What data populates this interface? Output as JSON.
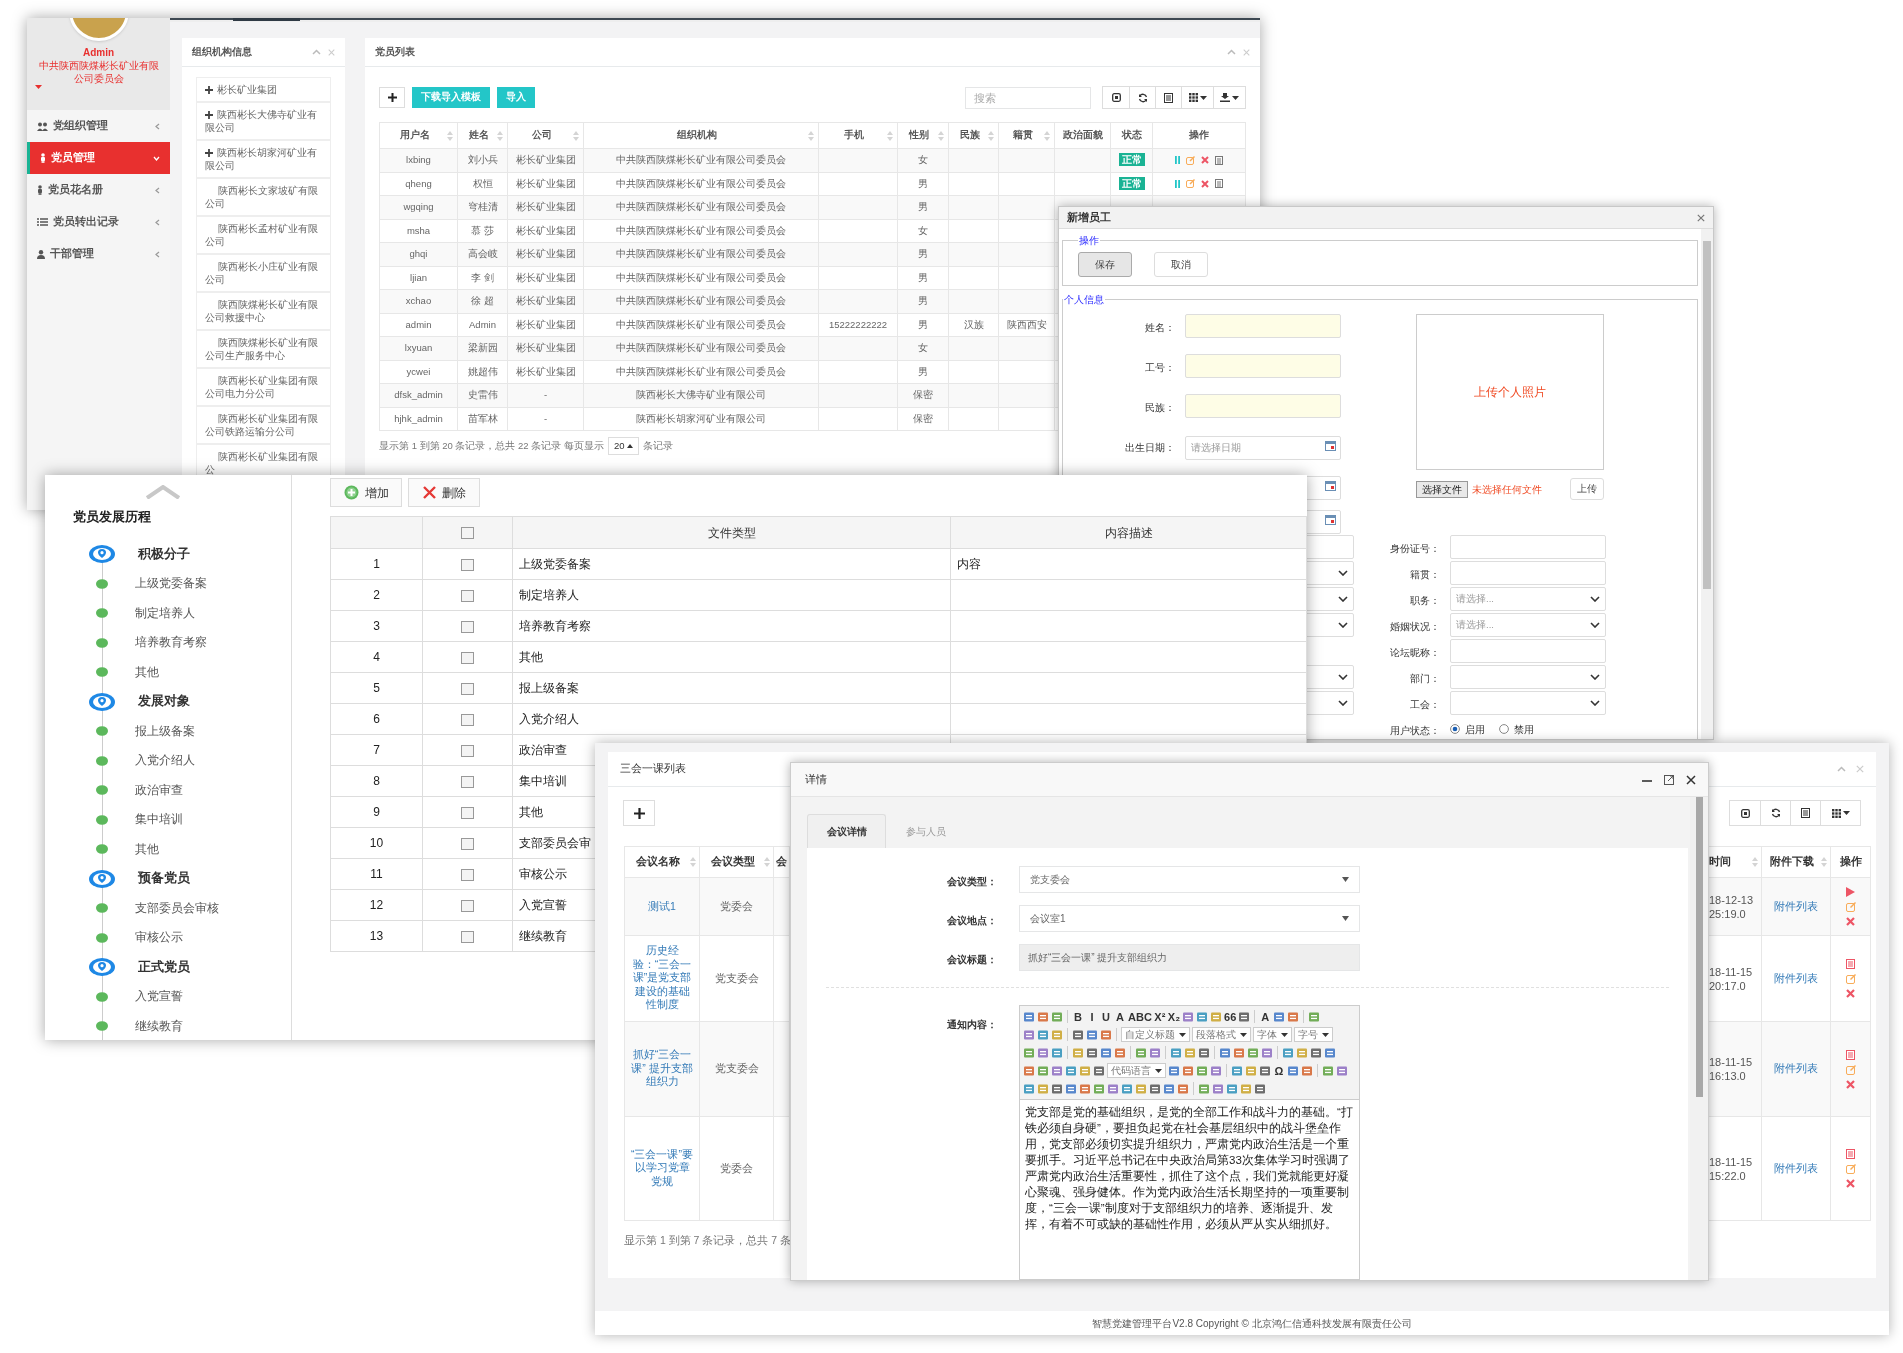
{
  "admin_window": {
    "sidebar": {
      "user_name": "Admin",
      "org_name": "中共陕西陕煤彬长矿业有限公司委员会",
      "menu": [
        {
          "label": "党组织管理",
          "selected": false
        },
        {
          "label": "党员管理",
          "selected": true
        },
        {
          "label": "党员花名册",
          "selected": false
        },
        {
          "label": "党员转出记录",
          "selected": false
        },
        {
          "label": "干部管理",
          "selected": false
        }
      ]
    },
    "org_panel": {
      "title": "组织机构信息",
      "items": [
        {
          "label": "彬长矿业集团",
          "expandable": true
        },
        {
          "label": "陕西彬长大佛寺矿业有限公司",
          "expandable": true
        },
        {
          "label": "陕西彬长胡家河矿业有限公司",
          "expandable": true
        },
        {
          "label": "陕西彬长文家坡矿有限公司",
          "expandable": false
        },
        {
          "label": "陕西彬长孟村矿业有限公司",
          "expandable": false
        },
        {
          "label": "陕西彬长小庄矿业有限公司",
          "expandable": false
        },
        {
          "label": "陕西陕煤彬长矿业有限公司救援中心",
          "expandable": false
        },
        {
          "label": "陕西陕煤彬长矿业有限公司生产服务中心",
          "expandable": false
        },
        {
          "label": "陕西彬长矿业集团有限公司电力分公司",
          "expandable": false
        },
        {
          "label": "陕西彬长矿业集团有限公司铁路运输分公司",
          "expandable": false
        },
        {
          "label": "陕西彬长矿业集团有限公",
          "expandable": false
        }
      ]
    },
    "member_panel": {
      "title": "党员列表",
      "buttons": [
        {
          "label": "下载导入模板"
        },
        {
          "label": "导入"
        }
      ],
      "search": {
        "placeholder": "搜索"
      },
      "columns": [
        {
          "label": "用户名",
          "sortable": true
        },
        {
          "label": "姓名",
          "sortable": true
        },
        {
          "label": "公司",
          "sortable": true
        },
        {
          "label": "组织机构",
          "sortable": true
        },
        {
          "label": "手机",
          "sortable": true
        },
        {
          "label": "性别",
          "sortable": true
        },
        {
          "label": "民族",
          "sortable": true
        },
        {
          "label": "籍贯",
          "sortable": true
        },
        {
          "label": "政治面貌",
          "sortable": false
        },
        {
          "label": "状态",
          "sortable": false
        },
        {
          "label": "操作",
          "sortable": false
        }
      ],
      "rows": [
        {
          "user": "lxbing",
          "name": "刘小兵",
          "company": "彬长矿业集团",
          "org": "中共陕西陕煤彬长矿业有限公司委员会",
          "gender": "女",
          "status": "正常",
          "actions": true
        },
        {
          "user": "qheng",
          "name": "权恒",
          "company": "彬长矿业集团",
          "org": "中共陕西陕煤彬长矿业有限公司委员会",
          "gender": "男",
          "status": "正常",
          "actions": true
        },
        {
          "user": "wgqing",
          "name": "穹桂清",
          "company": "彬长矿业集团",
          "org": "中共陕西陕煤彬长矿业有限公司委员会",
          "gender": "男",
          "actions": false
        },
        {
          "user": "msha",
          "name": "慕 莎",
          "company": "彬长矿业集团",
          "org": "中共陕西陕煤彬长矿业有限公司委员会",
          "gender": "女",
          "actions": false
        },
        {
          "user": "ghqi",
          "name": "高会岐",
          "company": "彬长矿业集团",
          "org": "中共陕西陕煤彬长矿业有限公司委员会",
          "gender": "男",
          "actions": false
        },
        {
          "user": "ljian",
          "name": "李 剑",
          "company": "彬长矿业集团",
          "org": "中共陕西陕煤彬长矿业有限公司委员会",
          "gender": "男",
          "actions": false
        },
        {
          "user": "xchao",
          "name": "徐 超",
          "company": "彬长矿业集团",
          "org": "中共陕西陕煤彬长矿业有限公司委员会",
          "gender": "男",
          "actions": false
        },
        {
          "user": "admin",
          "name": "Admin",
          "company": "彬长矿业集团",
          "org": "中共陕西陕煤彬长矿业有限公司委员会",
          "phone": "15222222222",
          "gender": "男",
          "nation": "汉族",
          "native": "陕西西安",
          "actions": false
        },
        {
          "user": "lxyuan",
          "name": "梁新园",
          "company": "彬长矿业集团",
          "org": "中共陕西陕煤彬长矿业有限公司委员会",
          "gender": "女",
          "actions": false
        },
        {
          "user": "ycwei",
          "name": "姚超伟",
          "company": "彬长矿业集团",
          "org": "中共陕西陕煤彬长矿业有限公司委员会",
          "gender": "男",
          "actions": false
        },
        {
          "user": "dfsk_admin",
          "name": "史雷伟",
          "company": "-",
          "org": "陕西彬长大佛寺矿业有限公司",
          "gender": "保密",
          "actions": false
        },
        {
          "user": "hjhk_admin",
          "name": "苗军林",
          "company": "-",
          "org": "陕西彬长胡家河矿业有限公司",
          "gender": "保密",
          "actions": false
        }
      ],
      "pagination": {
        "summary": "显示第 1 到第 20 条记录，总共 22 条记录 每页显示",
        "page_size": "20",
        "suffix": "条记录"
      }
    }
  },
  "new_employee_dialog": {
    "title": "新增员工",
    "actions_legend": "操作",
    "buttons": [
      {
        "label": "保存",
        "primary": true
      },
      {
        "label": "取消",
        "primary": false
      }
    ],
    "info_legend": "个人信息",
    "top_fields": [
      {
        "label": "姓名：",
        "kind": "text",
        "required": true
      },
      {
        "label": "工号：",
        "kind": "text",
        "required": true
      },
      {
        "label": "民族：",
        "kind": "text",
        "required": true
      },
      {
        "label": "出生日期：",
        "kind": "date",
        "placeholder": "请选择日期",
        "required": false
      },
      {
        "kind": "date",
        "required": false
      },
      {
        "kind": "date",
        "required": false
      }
    ],
    "photo": {
      "hint": "上传个人照片",
      "choose_button": "选择文件",
      "file_status": "未选择任何文件",
      "upload_button": "上传"
    },
    "rows": [
      {
        "left": {
          "kind": "text"
        },
        "right": {
          "label": "身份证号：",
          "kind": "text"
        }
      },
      {
        "left": {
          "kind": "select"
        },
        "right": {
          "label": "籍贯：",
          "kind": "text"
        }
      },
      {
        "left": {
          "kind": "select"
        },
        "right": {
          "label": "职务：",
          "kind": "select",
          "placeholder": "请选择..."
        }
      },
      {
        "left": {
          "kind": "select"
        },
        "right": {
          "label": "婚姻状况：",
          "kind": "select",
          "placeholder": "请选择..."
        }
      },
      {
        "right": {
          "label": "论坛昵称：",
          "kind": "text"
        }
      },
      {
        "left": {
          "kind": "select"
        },
        "right": {
          "label": "部门：",
          "kind": "select"
        }
      },
      {
        "left": {
          "kind": "select"
        },
        "right": {
          "label": "工会：",
          "kind": "select"
        }
      },
      {
        "right": {
          "label": "用户状态：",
          "kind": "radio",
          "options": [
            {
              "label": "启用",
              "selected": true
            },
            {
              "label": "禁用",
              "selected": false
            }
          ]
        }
      }
    ]
  },
  "development_window": {
    "timeline": {
      "title": "党员发展历程",
      "stages": [
        {
          "label": "积极分子",
          "steps": [
            "上级党委备案",
            "制定培养人",
            "培养教育考察",
            "其他"
          ]
        },
        {
          "label": "发展对象",
          "steps": [
            "报上级备案",
            "入党介绍人",
            "政治审查",
            "集中培训",
            "其他"
          ]
        },
        {
          "label": "预备党员",
          "steps": [
            "支部委员会审核",
            "审核公示"
          ]
        },
        {
          "label": "正式党员",
          "steps": [
            "入党宣誓",
            "继续教育"
          ]
        }
      ]
    },
    "toolbar": [
      {
        "kind": "add",
        "label": "增加"
      },
      {
        "kind": "delete",
        "label": "删除"
      }
    ],
    "columns": [
      "文件类型",
      "内容描述"
    ],
    "header_checked": false,
    "rows": [
      {
        "index": "1",
        "checked": false,
        "type": "上级党委备案",
        "description": "内容"
      },
      {
        "index": "2",
        "checked": false,
        "type": "制定培养人"
      },
      {
        "index": "3",
        "checked": false,
        "type": "培养教育考察"
      },
      {
        "index": "4",
        "checked": false,
        "type": "其他"
      },
      {
        "index": "5",
        "checked": false,
        "type": "报上级备案"
      },
      {
        "index": "6",
        "checked": false,
        "type": "入党介绍人"
      },
      {
        "index": "7",
        "checked": false,
        "type": "政治审查"
      },
      {
        "index": "8",
        "checked": false,
        "type": "集中培训"
      },
      {
        "index": "9",
        "checked": false,
        "type": "其他"
      },
      {
        "index": "10",
        "checked": false,
        "type": "支部委员会审"
      },
      {
        "index": "11",
        "checked": false,
        "type": "审核公示"
      },
      {
        "index": "12",
        "checked": false,
        "type": "入党宣誓"
      },
      {
        "index": "13",
        "checked": false,
        "type": "继续教育"
      }
    ]
  },
  "meeting_list_window": {
    "title": "三会一课列表",
    "columns": [
      {
        "label": "会议名称",
        "sortable": true
      },
      {
        "label": "会议类型",
        "sortable": true
      },
      {
        "label": "会"
      },
      {
        "label": "时间",
        "sortable": true
      },
      {
        "label": "附件下载",
        "sortable": true
      },
      {
        "label": "操作",
        "sortable": false
      }
    ],
    "rows": [
      {
        "name": "测试1",
        "type": "党委会",
        "date": "18-12-13",
        "time": "25:19.0",
        "attachment": "附件列表",
        "kind": "play"
      },
      {
        "name": "历史经验：“三会一课”是党支部建设的基础性制度",
        "type": "党支委会",
        "date": "18-11-15",
        "time": "20:17.0",
        "attachment": "附件列表",
        "kind": "list"
      },
      {
        "name": "抓好“三会一课” 提升支部组织力",
        "type": "党支委会",
        "date": "18-11-15",
        "time": "16:13.0",
        "attachment": "附件列表",
        "kind": "list"
      },
      {
        "name": "“三会一课”要以学习党章党规",
        "type": "党委会",
        "date": "18-11-15",
        "time": "15:22.0",
        "attachment": "附件列表",
        "kind": "list"
      }
    ],
    "pagination": "显示第 1 到第 7 条记录，总共 7 条"
  },
  "detail_dialog": {
    "title": "详情",
    "tabs": [
      {
        "label": "会议详情",
        "selected": true
      },
      {
        "label": "参与人员",
        "selected": false
      }
    ],
    "fields": [
      {
        "label": "会议类型：",
        "kind": "select",
        "value": "党支委会"
      },
      {
        "label": "会议地点：",
        "kind": "select",
        "value": "会议室1"
      },
      {
        "label": "会议标题：",
        "kind": "readonly",
        "value": "抓好“三会一课” 提升支部组织力"
      }
    ],
    "editor": {
      "label": "通知内容：",
      "toolbar": [
        [
          {
            "kind": "icon"
          },
          {
            "kind": "icon"
          },
          {
            "kind": "icon"
          },
          {
            "kind": "sep"
          },
          {
            "kind": "glyph",
            "text": "B"
          },
          {
            "kind": "glyph",
            "text": "I"
          },
          {
            "kind": "glyph",
            "text": "U"
          },
          {
            "kind": "glyph",
            "text": "A"
          },
          {
            "kind": "glyph",
            "text": "ABC"
          },
          {
            "kind": "glyph",
            "text": "X²"
          },
          {
            "kind": "glyph",
            "text": "X₂"
          },
          {
            "kind": "icon"
          },
          {
            "kind": "icon"
          },
          {
            "kind": "icon"
          },
          {
            "kind": "glyph",
            "text": "66"
          },
          {
            "kind": "icon"
          },
          {
            "kind": "sep"
          },
          {
            "kind": "glyph",
            "text": "A"
          },
          {
            "kind": "icon"
          },
          {
            "kind": "icon"
          },
          {
            "kind": "sep"
          },
          {
            "kind": "icon"
          }
        ],
        [
          {
            "kind": "icon"
          },
          {
            "kind": "icon"
          },
          {
            "kind": "icon"
          },
          {
            "kind": "sep"
          },
          {
            "kind": "icon"
          },
          {
            "kind": "icon"
          },
          {
            "kind": "icon"
          },
          {
            "kind": "sep"
          },
          {
            "kind": "select",
            "text": "自定义标题"
          },
          {
            "kind": "select",
            "text": "段落格式"
          },
          {
            "kind": "select",
            "text": "字体"
          },
          {
            "kind": "select",
            "text": "字号"
          }
        ],
        [
          {
            "kind": "icon"
          },
          {
            "kind": "icon"
          },
          {
            "kind": "icon"
          },
          {
            "kind": "sep"
          },
          {
            "kind": "icon"
          },
          {
            "kind": "icon"
          },
          {
            "kind": "icon"
          },
          {
            "kind": "icon"
          },
          {
            "kind": "sep"
          },
          {
            "kind": "icon"
          },
          {
            "kind": "icon"
          },
          {
            "kind": "sep"
          },
          {
            "kind": "icon"
          },
          {
            "kind": "icon"
          },
          {
            "kind": "icon"
          },
          {
            "kind": "sep"
          },
          {
            "kind": "icon"
          },
          {
            "kind": "icon"
          },
          {
            "kind": "icon"
          },
          {
            "kind": "icon"
          },
          {
            "kind": "sep"
          },
          {
            "kind": "icon"
          },
          {
            "kind": "icon"
          },
          {
            "kind": "icon"
          },
          {
            "kind": "icon"
          }
        ],
        [
          {
            "kind": "icon"
          },
          {
            "kind": "icon"
          },
          {
            "kind": "icon"
          },
          {
            "kind": "icon"
          },
          {
            "kind": "icon"
          },
          {
            "kind": "icon"
          },
          {
            "kind": "select",
            "text": "代码语言"
          },
          {
            "kind": "icon"
          },
          {
            "kind": "icon"
          },
          {
            "kind": "icon"
          },
          {
            "kind": "icon"
          },
          {
            "kind": "sep"
          },
          {
            "kind": "icon"
          },
          {
            "kind": "icon"
          },
          {
            "kind": "icon"
          },
          {
            "kind": "glyph",
            "text": "Ω"
          },
          {
            "kind": "icon"
          },
          {
            "kind": "icon"
          },
          {
            "kind": "sep"
          },
          {
            "kind": "icon"
          },
          {
            "kind": "icon"
          }
        ],
        [
          {
            "kind": "icon"
          },
          {
            "kind": "icon"
          },
          {
            "kind": "icon"
          },
          {
            "kind": "icon"
          },
          {
            "kind": "icon"
          },
          {
            "kind": "icon"
          },
          {
            "kind": "icon"
          },
          {
            "kind": "icon"
          },
          {
            "kind": "icon"
          },
          {
            "kind": "icon"
          },
          {
            "kind": "icon"
          },
          {
            "kind": "icon"
          },
          {
            "kind": "sep"
          },
          {
            "kind": "icon"
          },
          {
            "kind": "icon"
          },
          {
            "kind": "icon"
          },
          {
            "kind": "icon"
          },
          {
            "kind": "icon"
          }
        ]
      ],
      "content": "党支部是党的基础组织，是党的全部工作和战斗力的基础。“打铁必须自身硬”，要担负起党在社会基层组织中的战斗堡垒作用，党支部必须切实提升组织力，严肃党内政治生活是一个重要抓手。习近平总书记在中央政治局第33次集体学习时强调了严肃党内政治生活重要性，抓住了这个点，我们党就能更好凝心聚魂、强身健体。作为党内政治生活长期坚持的一项重要制度，“三会一课”制度对于支部组织力的培养、逐渐提升、发挥，有着不可或缺的基础性作用，必须从严从实从细抓好。"
    }
  },
  "footer": "智慧党建管理平台V2.8 Copyright © 北京鸿仁信通科技发展有限责任公司"
}
